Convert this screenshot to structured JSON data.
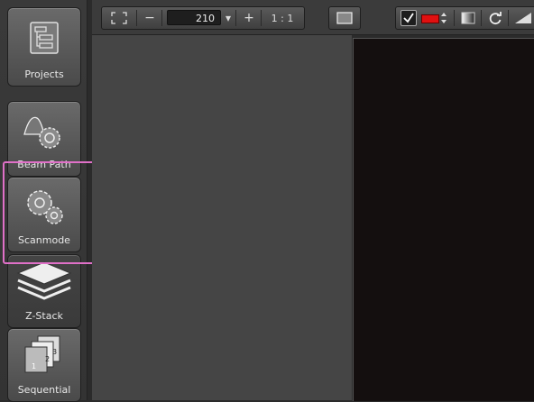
{
  "sidebar": {
    "items": [
      {
        "label": "Projects",
        "icon": "projects-icon"
      },
      {
        "label": "Beam Path",
        "icon": "beam-path-icon"
      },
      {
        "label": "Scanmode",
        "icon": "scanmode-icon"
      },
      {
        "label": "Z-Stack",
        "icon": "z-stack-icon"
      },
      {
        "label": "Sequential",
        "icon": "sequential-icon"
      }
    ]
  },
  "toolbar": {
    "fit_icon": "fit-frame-icon",
    "zoom_out_label": "−",
    "zoom_value": "210",
    "zoom_dropdown": "▾",
    "zoom_in_label": "+",
    "ratio_label": "1 : 1",
    "view_icon": "image-view-icon",
    "check_icon": "check-icon",
    "color_swatch": "#e01010",
    "contrast_icon": "contrast-icon",
    "refresh_icon": "refresh-icon",
    "gradient_icon": "gradient-icon"
  },
  "highlight_color": "#e070c8"
}
